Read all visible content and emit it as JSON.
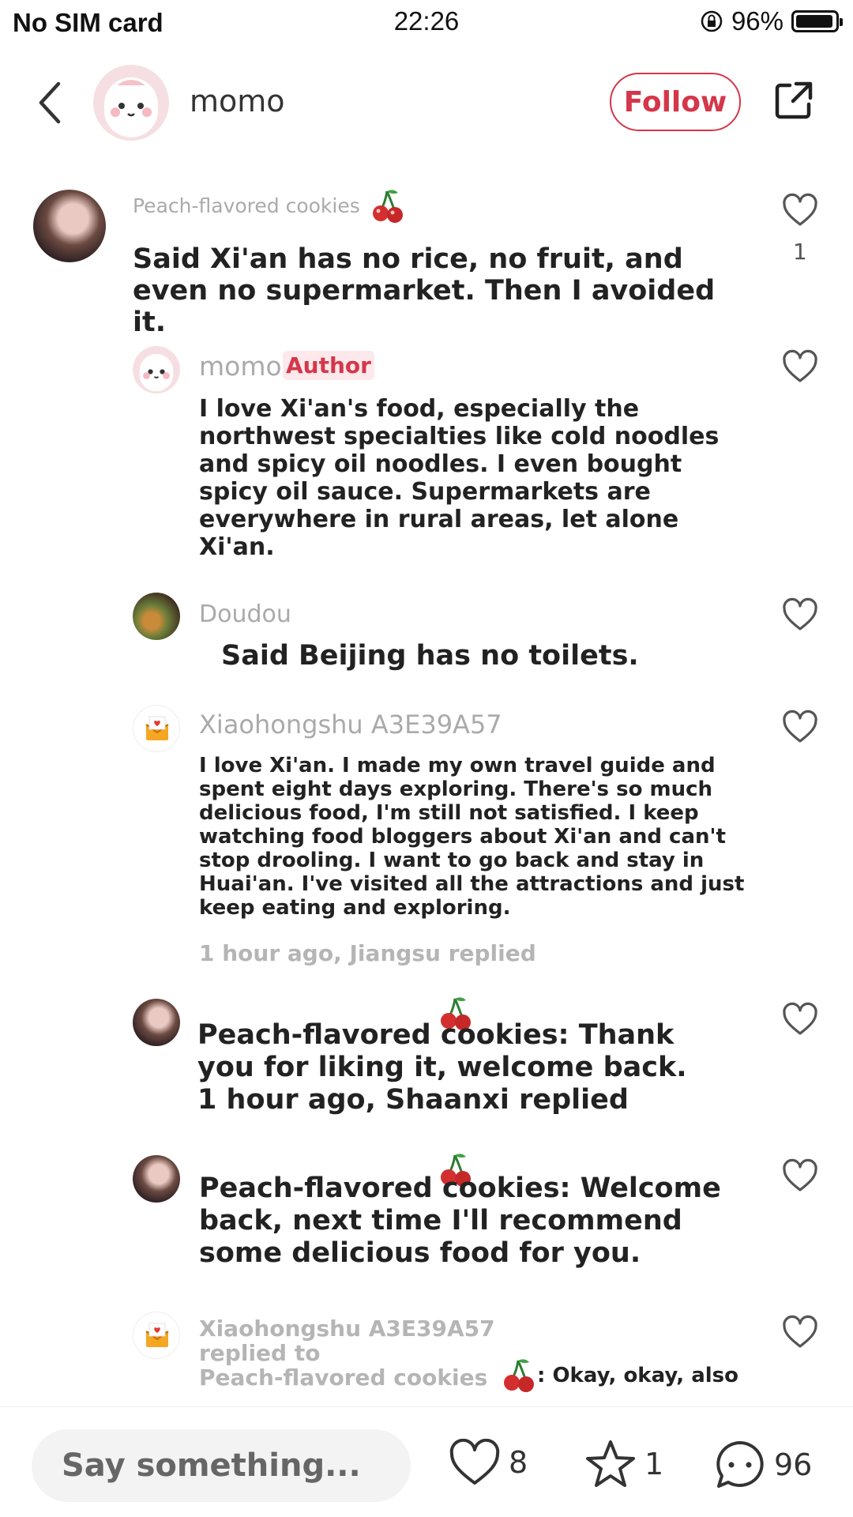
{
  "status_bar": {
    "carrier": "No SIM card",
    "time": "22:26",
    "battery": "96%",
    "battery_level": 0.96
  },
  "header": {
    "name": "momo",
    "follow_label": "Follow"
  },
  "comments": {
    "c1": {
      "user": "Peach-flavored cookies",
      "text_line1": "Said Xi'an has no rice, no fruit, and",
      "text_line2": "even no supermarket. Then I avoided it.",
      "likes": "1"
    },
    "c2": {
      "user": "momo",
      "badge": "Author",
      "lines": [
        "I love Xi'an's food, especially the",
        "northwest specialties like cold noodles",
        "and spicy oil noodles. I even bought",
        "spicy oil sauce. Supermarkets are",
        "everywhere in rural areas, let alone",
        "Xi'an."
      ]
    },
    "c3": {
      "user": "Doudou",
      "text": "Said Beijing has no toilets."
    },
    "c4": {
      "user": "Xiaohongshu A3E39A57",
      "lines": [
        "I love Xi'an. I made my own travel guide and",
        "spent eight days exploring. There's so much",
        "delicious food, I'm still not satisfied. I keep",
        "watching food bloggers about Xi'an and can't",
        "stop drooling. I want to go back and stay in",
        "Huai'an. I've visited all the attractions and just",
        "keep eating and exploring."
      ],
      "meta": "1 hour ago, Jiangsu replied"
    },
    "c5": {
      "lines": [
        "Peach-flavored cookies: Thank",
        "you for liking it, welcome back.",
        "1 hour ago, Shaanxi replied"
      ]
    },
    "c6": {
      "lines": [
        "Peach-flavored cookies: Welcome",
        "back, next time I'll recommend",
        "some delicious food for you."
      ]
    },
    "c7": {
      "user": "Xiaohongshu A3E39A57",
      "replied_to": "replied to",
      "target": "Peach-flavored cookies",
      "text": ": Okay, okay, also"
    }
  },
  "bottom_bar": {
    "input_placeholder": "Say something...",
    "likes": "8",
    "stars": "1",
    "comments": "96"
  },
  "colors": {
    "accent": "#d4374a",
    "muted_text": "#aaaaaa",
    "input_bg": "#f3f3f3"
  }
}
